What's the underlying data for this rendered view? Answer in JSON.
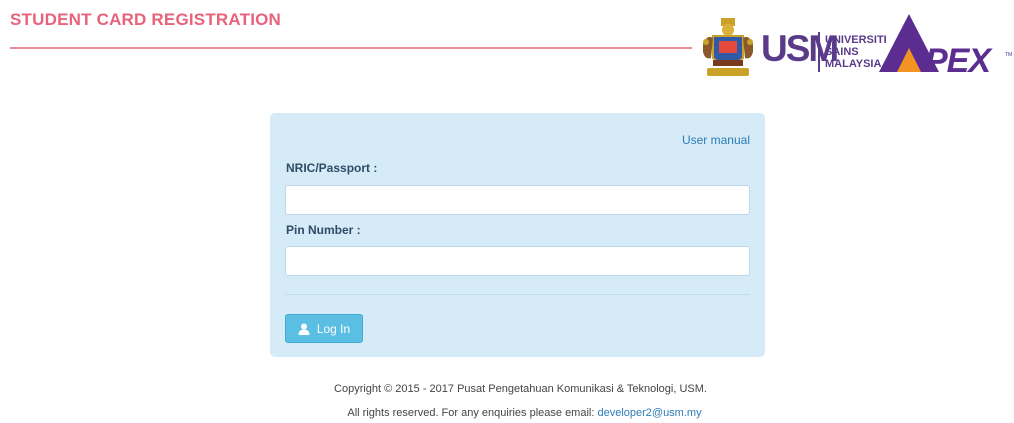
{
  "header": {
    "title": "STUDENT CARD REGISTRATION",
    "usm_mark": "USM",
    "usm_text_lines": [
      "UNIVERSITI",
      "SAINS",
      "MALAYSIA"
    ],
    "apex_text": "APEX"
  },
  "login_panel": {
    "user_manual_link": "User manual",
    "nric_label": "NRIC/Passport :",
    "nric_value": "",
    "pin_label": "Pin Number :",
    "pin_value": "",
    "login_button_label": "Log In"
  },
  "footer": {
    "copyright": "Copyright © 2015 - 2017 Pusat Pengetahuan Komunikasi & Teknologi, USM.",
    "rights_text": "All rights reserved. For any enquiries please email: ",
    "email": "developer2@usm.my"
  },
  "colors": {
    "title": "#e8637a",
    "panel_bg": "#d5ebf7",
    "button": "#5bbfe3",
    "link": "#2e7cb5",
    "usm_purple": "#5a3b8a",
    "apex_purple": "#5b2d91",
    "apex_orange": "#f39323"
  },
  "icons": {
    "login_button_icon": "user-icon"
  }
}
